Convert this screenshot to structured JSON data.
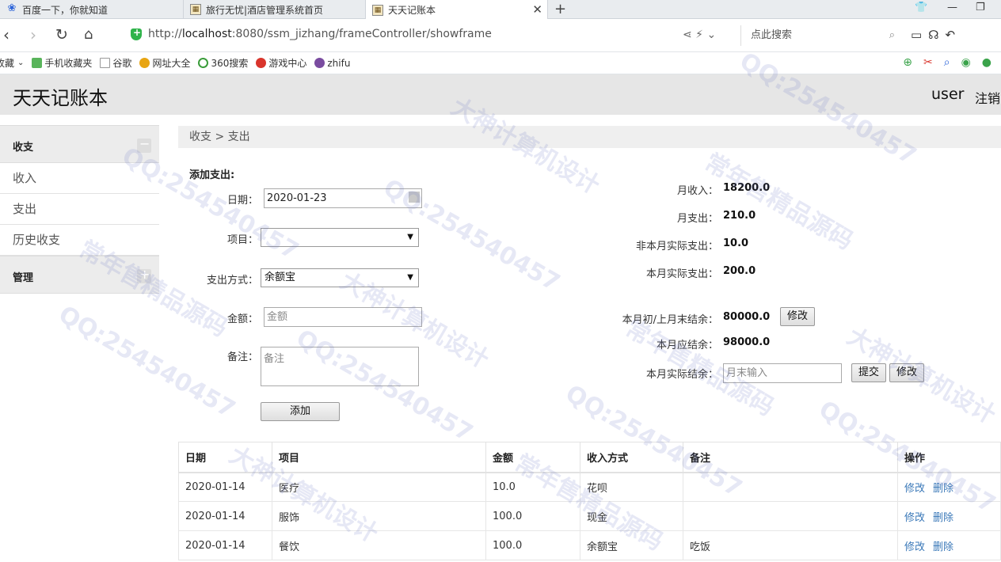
{
  "browser": {
    "tabs": [
      {
        "title": "百度一下，你就知道",
        "icon": "baidu-icon"
      },
      {
        "title": "旅行无忧|酒店管理系统首页",
        "icon": "page-icon"
      },
      {
        "title": "天天记账本",
        "icon": "page-icon",
        "active": true
      }
    ],
    "url_scheme": "http://",
    "url_host": "localhost",
    "url_path": ":8080/ssm_jizhang/frameController/showframe",
    "search_placeholder": "点此搜索",
    "bookmarks": [
      {
        "label": "收藏",
        "icon": "star-icon"
      },
      {
        "label": "手机收藏夹",
        "icon": "phone-icon"
      },
      {
        "label": "谷歌",
        "icon": "page-icon"
      },
      {
        "label": "网址大全",
        "icon": "globe-icon"
      },
      {
        "label": "360搜索",
        "icon": "search-icon"
      },
      {
        "label": "游戏中心",
        "icon": "game-icon"
      },
      {
        "label": "zhifu",
        "icon": "page-icon"
      }
    ]
  },
  "app": {
    "title": "天天记账本",
    "user": "user",
    "logout": "注销"
  },
  "sidebar": {
    "groups": [
      {
        "label": "收支",
        "items": [
          "收入",
          "支出",
          "历史收支"
        ]
      },
      {
        "label": "管理",
        "items": []
      }
    ]
  },
  "breadcrumb": "收支 > 支出",
  "form": {
    "title": "添加支出:",
    "date_label": "日期：",
    "date_value": "2020-01-23",
    "item_label": "项目：",
    "item_value": "",
    "method_label": "支出方式：",
    "method_value": "余额宝",
    "amount_label": "金额：",
    "amount_placeholder": "金额",
    "note_label": "备注：",
    "note_placeholder": "备注",
    "submit": "添加"
  },
  "stats": {
    "month_income_label": "月收入：",
    "month_income": "18200.0",
    "month_expense_label": "月支出：",
    "month_expense": "210.0",
    "other_month_actual_label": "非本月实际支出：",
    "other_month_actual": "10.0",
    "this_month_actual_label": "本月实际支出：",
    "this_month_actual": "200.0",
    "opening_balance_label": "本月初/上月末结余：",
    "opening_balance": "80000.0",
    "opening_edit": "修改",
    "expected_balance_label": "本月应结余：",
    "expected_balance": "98000.0",
    "actual_balance_label": "本月实际结余：",
    "actual_balance_placeholder": "月末输入",
    "actual_submit": "提交",
    "actual_edit": "修改"
  },
  "table": {
    "headers": [
      "日期",
      "项目",
      "金额",
      "收入方式",
      "备注",
      "操作"
    ],
    "rows": [
      {
        "date": "2020-01-14",
        "item": "医疗",
        "amount": "10.0",
        "method": "花呗",
        "note": "",
        "edit": "修改",
        "delete": "删除"
      },
      {
        "date": "2020-01-14",
        "item": "服饰",
        "amount": "100.0",
        "method": "现金",
        "note": "",
        "edit": "修改",
        "delete": "删除"
      },
      {
        "date": "2020-01-14",
        "item": "餐饮",
        "amount": "100.0",
        "method": "余额宝",
        "note": "吃饭",
        "edit": "修改",
        "delete": "删除"
      }
    ]
  },
  "watermark": {
    "qq": "QQ:254540457",
    "a": "大神计算机设计",
    "b": "常年售精品源码"
  }
}
